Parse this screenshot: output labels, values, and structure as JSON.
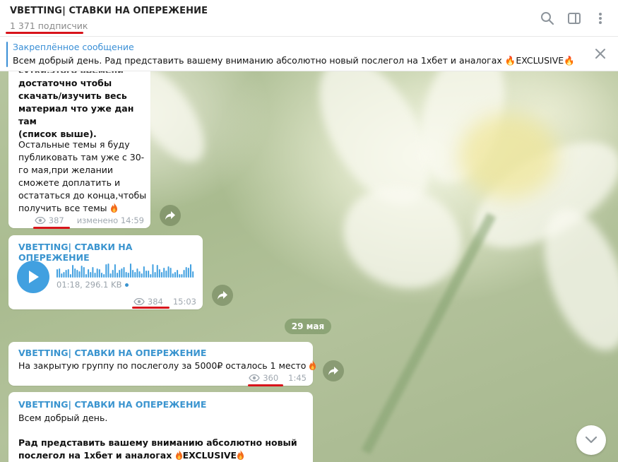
{
  "header": {
    "title": "VBETTING| СТАВКИ НА ОПЕРЕЖЕНИЕ",
    "subscribers": "1 371 подписчик"
  },
  "pinned": {
    "label": "Закреплённое сообщение",
    "text": "Всем добрый день.  Рад представить вашему вниманию абсолютно новый послегол на 1хбет и аналогах 🔥EXCLUSIVE🔥  По..."
  },
  "messages": [
    {
      "body_lines": [
        "достаточно чтобы",
        "скачать/изучить весь",
        "материал что уже дан там",
        "(список выше)."
      ],
      "body2_lines": [
        "Остальные темы я буду",
        "публиковать там уже с 30-",
        "го мая,при желании",
        "сможете доплатить и",
        "остататься до конца,чтобы",
        "получить все темы"
      ],
      "views": "387",
      "time": "изменено 14:59"
    },
    {
      "sender": "VBETTING| СТАВКИ НА ОПЕРЕЖЕНИЕ",
      "voice_info": "01:18, 296.1 KB",
      "views": "384",
      "time": "15:03"
    },
    {
      "sender": "VBETTING| СТАВКИ НА ОПЕРЕЖЕНИЕ",
      "body": "На закрытую группу по послеголу за 5000₽ осталось 1 место",
      "views": "360",
      "time": "1:45"
    },
    {
      "sender": "VBETTING| СТАВКИ НА ОПЕРЕЖЕНИЕ",
      "line1": "Всем добрый день.",
      "line2": "Рад представить вашему вниманию абсолютно новый",
      "line3": "послегол на 1хбет и аналогах",
      "line3_tag": "EXCLUSIVE"
    }
  ],
  "date_separator": "29 мая",
  "colors": {
    "accent": "#3a94cf",
    "play_button": "#41a0e0",
    "highlight_underline": "#d8141b"
  },
  "icons": [
    "search-icon",
    "sidebar-toggle-icon",
    "more-vertical-icon",
    "close-icon",
    "eye-icon",
    "forward-icon",
    "play-icon",
    "fire-icon",
    "chevron-down-icon"
  ]
}
